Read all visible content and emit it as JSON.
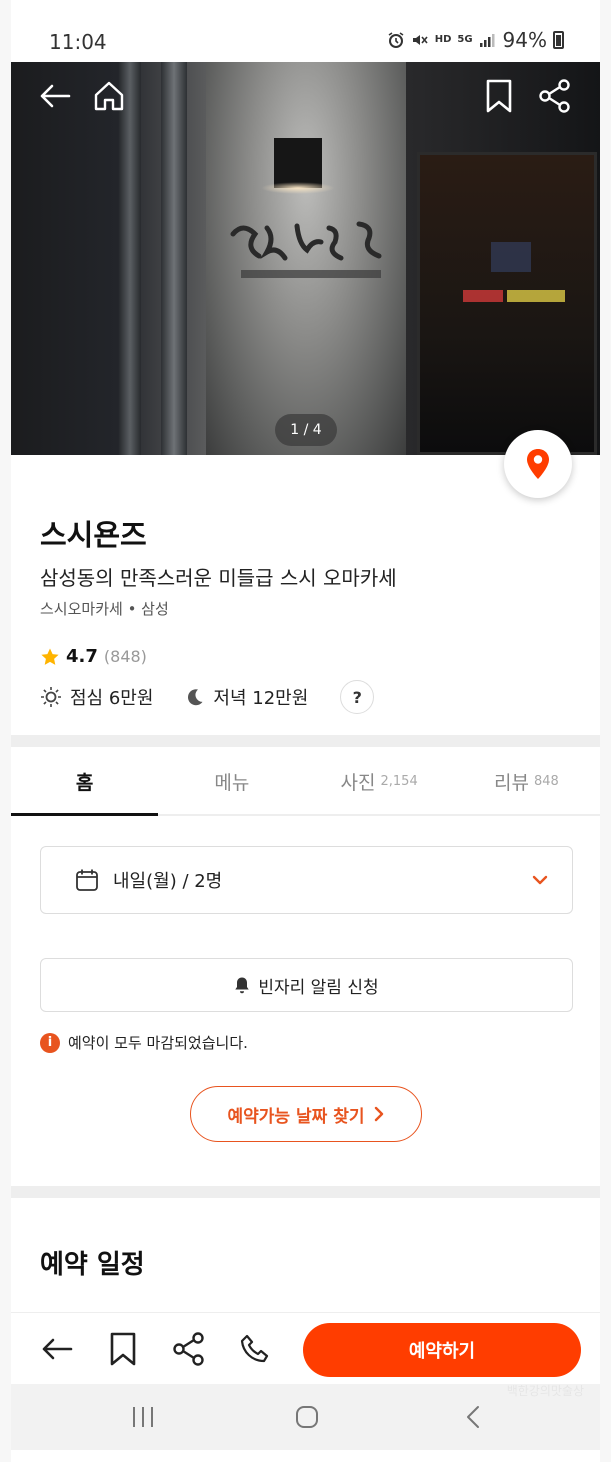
{
  "status_bar": {
    "time": "11:04",
    "battery": "94%",
    "hd_label": "HD",
    "net_label": "5G"
  },
  "hero": {
    "photo_counter": "1 / 4"
  },
  "restaurant": {
    "name": "스시욘즈",
    "description": "삼성동의 만족스러운 미들급 스시 오마카세",
    "category_location": "스시오마카세 • 삼성",
    "rating": "4.7",
    "review_count": "(848)",
    "lunch_price": "점심 6만원",
    "dinner_price": "저녁 12만원",
    "help_label": "?"
  },
  "tabs": [
    {
      "label": "홈",
      "count": ""
    },
    {
      "label": "메뉴",
      "count": ""
    },
    {
      "label": "사진",
      "count": "2,154"
    },
    {
      "label": "리뷰",
      "count": "848"
    }
  ],
  "booking": {
    "date_selection": "내일(월) / 2명",
    "vacancy_alert_label": "빈자리 알림 신청",
    "notice_text": "예약이 모두 마감되었습니다.",
    "notice_icon": "i",
    "find_dates_label": "예약가능 날짜 찾기"
  },
  "section": {
    "title": "예약 일정"
  },
  "bottom_bar": {
    "reserve_label": "예약하기"
  },
  "system_nav": {
    "watermark": "백한강의맛술상"
  },
  "colors": {
    "accent": "#ff3d00",
    "accent_text": "#e8541f",
    "divider": "#eeeeee"
  }
}
